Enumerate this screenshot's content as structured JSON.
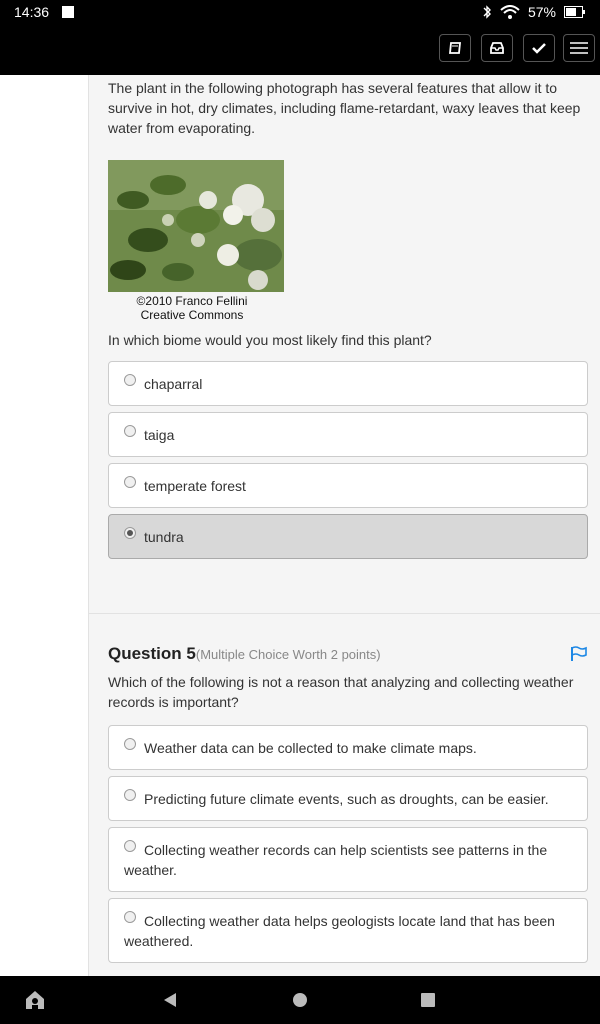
{
  "status_bar": {
    "time": "14:36",
    "battery": "57%"
  },
  "toolbar": {
    "buttons": [
      "book-icon",
      "inbox-icon",
      "check-icon",
      "menu-icon"
    ]
  },
  "question4": {
    "intro": "The plant in the following photograph has several features that allow it to survive in hot, dry climates, including flame-retardant, waxy leaves that keep water from evaporating.",
    "caption_line1": "©2010 Franco Fellini",
    "caption_line2": "Creative Commons",
    "prompt": "In which biome would you most likely find this plant?",
    "options": [
      "chaparral",
      "taiga",
      "temperate forest",
      "tundra"
    ],
    "selected": "tundra"
  },
  "question5": {
    "title": "Question 5",
    "subtitle": "(Multiple Choice Worth 2 points)",
    "prompt": "Which of the following is not a reason that analyzing and collecting weather records is important?",
    "options": [
      "Weather data can be collected to make climate maps.",
      "Predicting future climate events, such as droughts, can be easier.",
      "Collecting weather records can help scientists see patterns in the weather.",
      "Collecting weather data helps geologists locate land that has been weathered."
    ]
  },
  "colors": {
    "accent": "#1e88e5",
    "card_bg": "#f5f5f5",
    "selected_bg": "#d8d8d8"
  }
}
